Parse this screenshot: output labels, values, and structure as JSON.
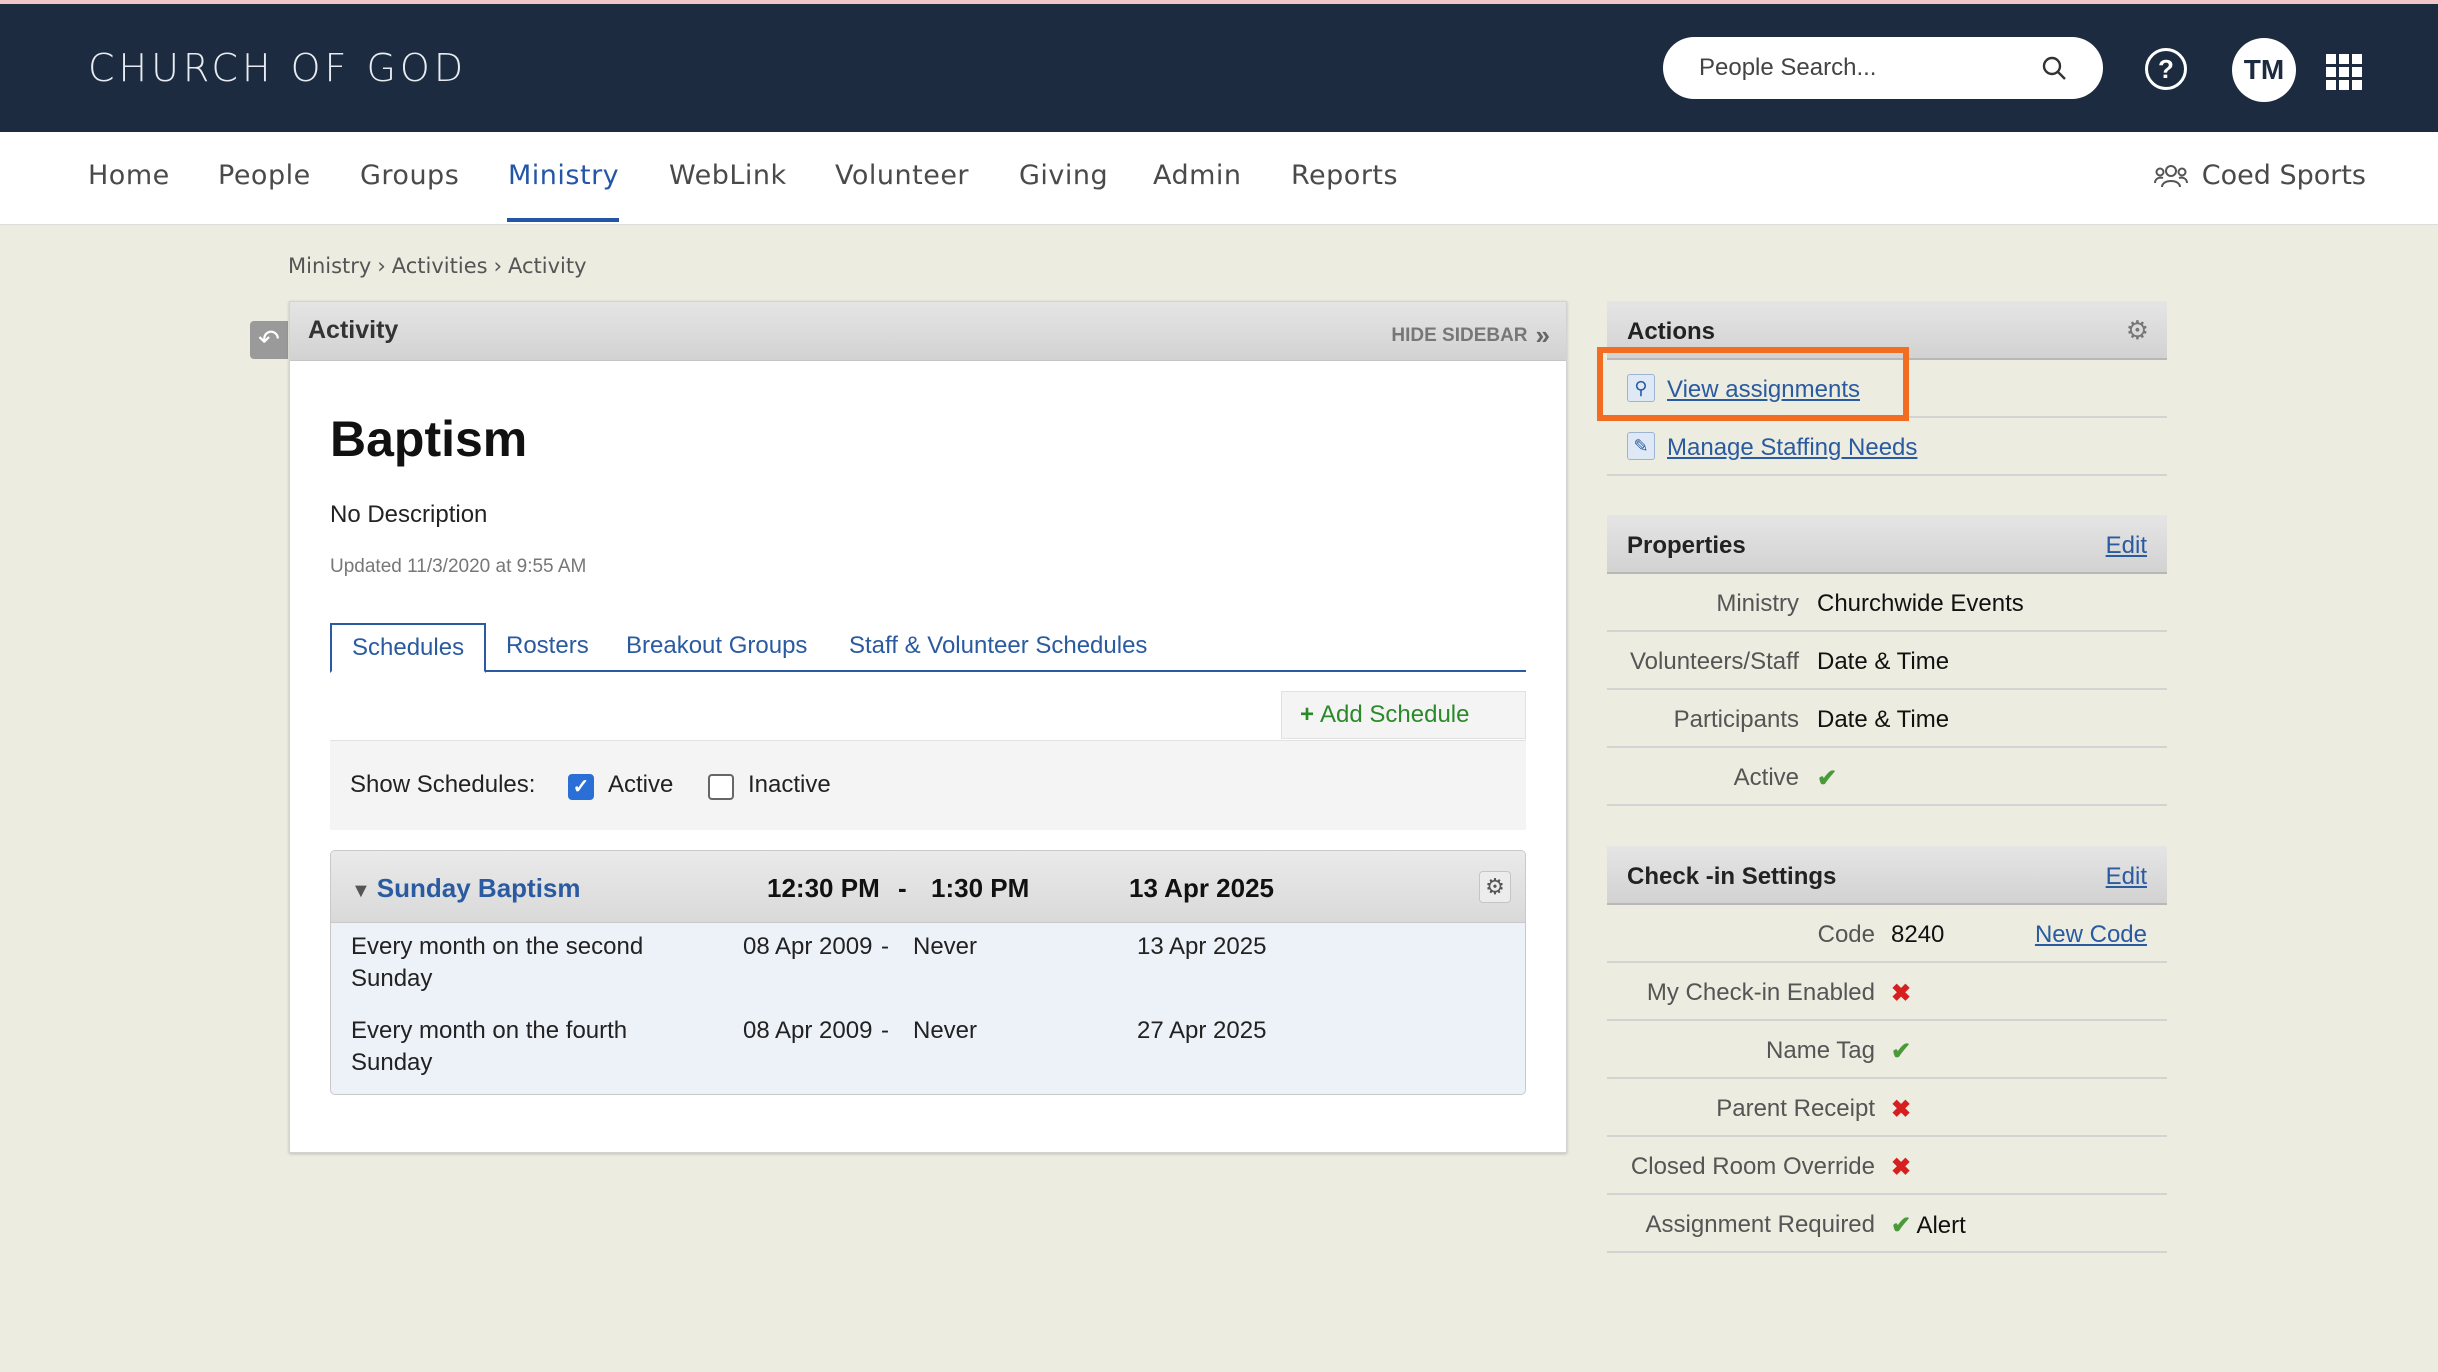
{
  "header": {
    "brand": "CHURCH OF GOD",
    "search_placeholder": "People Search...",
    "user_initials": "TM"
  },
  "nav": {
    "items": [
      "Home",
      "People",
      "Groups",
      "Ministry",
      "WebLink",
      "Volunteer",
      "Giving",
      "Admin",
      "Reports"
    ],
    "active": "Ministry",
    "context": "Coed Sports"
  },
  "breadcrumb": [
    "Ministry",
    "Activities",
    "Activity"
  ],
  "card": {
    "title": "Activity",
    "hide_sidebar": "HIDE SIDEBAR",
    "name": "Baptism",
    "description": "No Description",
    "updated": "Updated 11/3/2020 at 9:55 AM",
    "tabs": [
      "Schedules",
      "Rosters",
      "Breakout Groups",
      "Staff & Volunteer Schedules"
    ],
    "add_schedule": "Add Schedule",
    "show_schedules_label": "Show Schedules:",
    "filter_active": "Active",
    "filter_inactive": "Inactive",
    "filter_active_checked": true,
    "filter_inactive_checked": false,
    "schedule": {
      "name": "Sunday Baptism",
      "start": "12:30 PM",
      "dash": "-",
      "end": "1:30 PM",
      "next_date": "13 Apr 2025",
      "rows": [
        {
          "recurrence_l1": "Every month on the second",
          "recurrence_l2": "Sunday",
          "from": "08 Apr 2009",
          "dash": "-",
          "to": "Never",
          "next": "13 Apr 2025"
        },
        {
          "recurrence_l1": "Every month on the fourth",
          "recurrence_l2": "Sunday",
          "from": "08 Apr 2009",
          "dash": "-",
          "to": "Never",
          "next": "27 Apr 2025"
        }
      ]
    }
  },
  "sidebar": {
    "actions": {
      "title": "Actions",
      "items": [
        "View assignments",
        "Manage Staffing Needs"
      ]
    },
    "properties": {
      "title": "Properties",
      "edit": "Edit",
      "rows": [
        {
          "label": "Ministry",
          "value": "Churchwide Events"
        },
        {
          "label": "Volunteers/Staff",
          "value": "Date & Time"
        },
        {
          "label": "Participants",
          "value": "Date & Time"
        },
        {
          "label": "Active",
          "value": "✔"
        }
      ]
    },
    "checkin": {
      "title": "Check -in Settings",
      "edit": "Edit",
      "code_label": "Code",
      "code_value": "8240",
      "new_code": "New Code",
      "rows": [
        {
          "label": "My Check-in Enabled",
          "value": "✖",
          "status": "no"
        },
        {
          "label": "Name Tag",
          "value": "✔",
          "status": "ok"
        },
        {
          "label": "Parent Receipt",
          "value": "✖",
          "status": "no"
        },
        {
          "label": "Closed Room Override",
          "value": "✖",
          "status": "no"
        },
        {
          "label": "Assignment Required",
          "value": "✔",
          "status": "ok",
          "extra": "Alert"
        }
      ]
    }
  },
  "colors": {
    "topbar": "#1c2b3f",
    "accent": "#2456a8",
    "highlight": "#f26d21",
    "ok": "#4a9a3a",
    "no": "#d62020"
  }
}
